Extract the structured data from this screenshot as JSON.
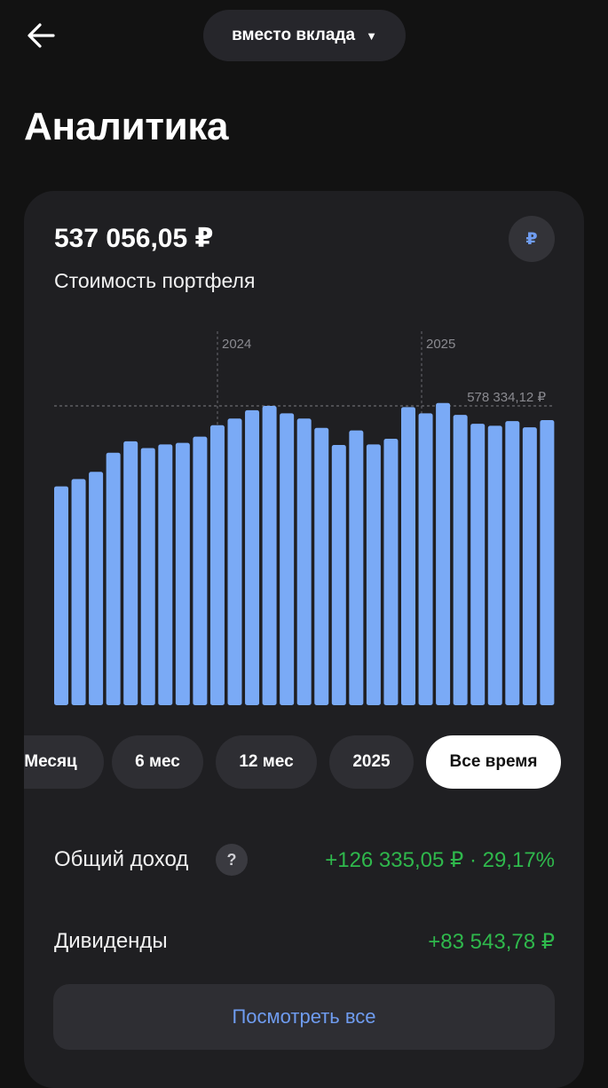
{
  "header": {
    "back_icon": "arrow-left-icon",
    "portfolio_label": "вместо вклада",
    "dropdown_icon": "caret-down-icon"
  },
  "page": {
    "title": "Аналитика"
  },
  "portfolio": {
    "value": "537 056,05 ₽",
    "caption": "Стоимость портфеля",
    "currency_symbol": "₽"
  },
  "chart_data": {
    "type": "bar",
    "year_markers": [
      "2024",
      "2025"
    ],
    "max_label": "578 334,12 ₽",
    "max_value": 578334.12,
    "ylim": [
      0,
      578334.12
    ],
    "bar_color": "#7aaaf6",
    "values": [
      422900,
      436900,
      450900,
      487900,
      509900,
      496900,
      503900,
      506900,
      518900,
      540900,
      553900,
      569900,
      578334.12,
      563900,
      553900,
      535900,
      502900,
      530900,
      503900,
      514900,
      575900,
      563900,
      584000,
      560900,
      543900,
      539900,
      548900,
      536900,
      550900
    ]
  },
  "periods": [
    {
      "label": "Месяц",
      "active": false
    },
    {
      "label": "6 мес",
      "active": false
    },
    {
      "label": "12 мес",
      "active": false
    },
    {
      "label": "2025",
      "active": false
    },
    {
      "label": "Все время",
      "active": true
    }
  ],
  "income": {
    "label": "Общий доход",
    "help_symbol": "?",
    "value": "+126 335,05 ₽ · 29,17%"
  },
  "dividends": {
    "label": "Дивиденды",
    "value": "+83 543,78 ₽"
  },
  "see_all": {
    "label": "Посмотреть все"
  },
  "colors": {
    "positive": "#2fb84c",
    "accent": "#6f9cf0",
    "background": "#121212",
    "card": "#1f1f22"
  }
}
